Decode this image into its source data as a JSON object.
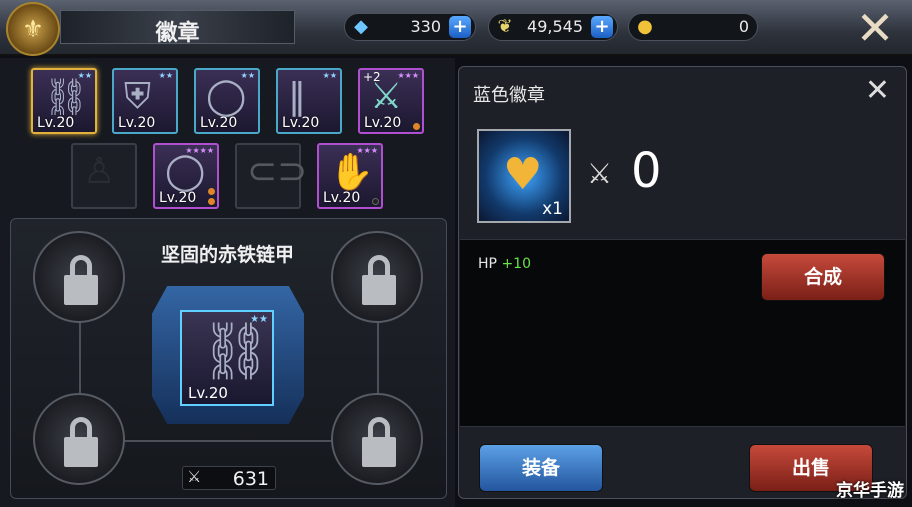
{
  "header": {
    "title": "徽章",
    "emblem_icon": "helmet-crest-icon"
  },
  "currencies": [
    {
      "icon": "diamond-icon",
      "value": "330",
      "has_plus": true
    },
    {
      "icon": "leaf-icon",
      "value": "49,545",
      "has_plus": true
    },
    {
      "icon": "coin-icon",
      "value": "0",
      "has_plus": false
    }
  ],
  "inventory": {
    "row1": [
      {
        "level": "Lv.20",
        "stars": "★★",
        "rarity": "blue",
        "selected": true,
        "item": "armor"
      },
      {
        "level": "Lv.20",
        "stars": "★★",
        "rarity": "blue",
        "item": "armor-plate"
      },
      {
        "level": "Lv.20",
        "stars": "★★",
        "rarity": "blue",
        "item": "ring"
      },
      {
        "level": "Lv.20",
        "stars": "★★",
        "rarity": "blue",
        "item": "greaves"
      },
      {
        "level": "Lv.20",
        "stars": "★★★",
        "rarity": "purple",
        "plus": "+2",
        "item": "weapon"
      }
    ],
    "row2": [
      {
        "level": "",
        "rarity": "empty",
        "item": "silhouette"
      },
      {
        "level": "Lv.20",
        "stars": "★★★★",
        "rarity": "purple",
        "item": "ring"
      },
      {
        "level": "",
        "rarity": "empty",
        "item": "belt"
      },
      {
        "level": "Lv.20",
        "stars": "★★★",
        "rarity": "purple",
        "item": "gloves"
      }
    ]
  },
  "equip": {
    "title": "坚固的赤铁链甲",
    "item_level": "Lv.20",
    "item_stars": "★★",
    "power": "631"
  },
  "detail": {
    "title": "蓝色徽章",
    "badge_qty": "x1",
    "count": "0",
    "stat_label": "HP",
    "stat_value": "+10",
    "combine_label": "合成",
    "equip_label": "装备",
    "sell_label": "出售"
  },
  "watermark": "京华手游",
  "colors": {
    "blue_rarity": "#4aa8c8",
    "purple_rarity": "#b04fd0",
    "selected": "#e2b23c",
    "stat_plus": "#69e24b",
    "btn_red": "#c64a3b",
    "btn_blue": "#5ca0e6"
  }
}
